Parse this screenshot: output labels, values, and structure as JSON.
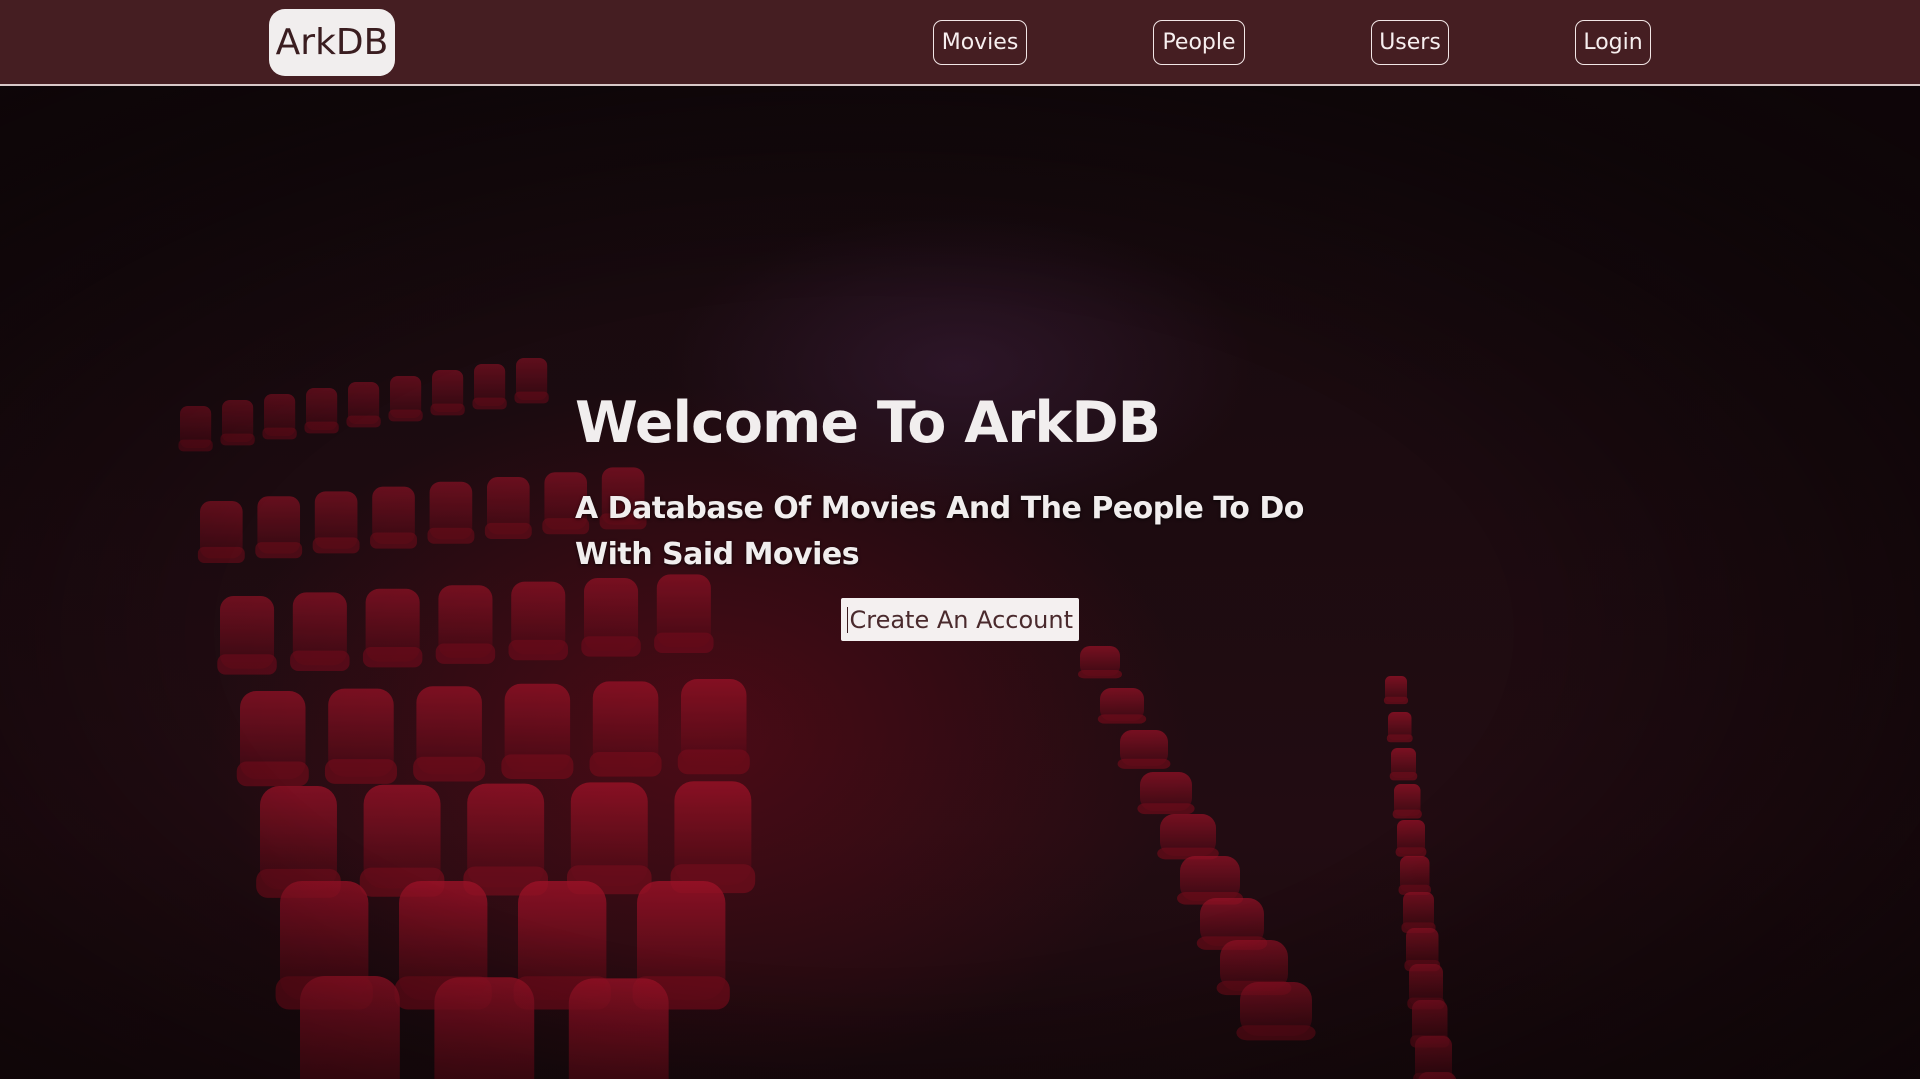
{
  "brand": {
    "label": "ArkDB"
  },
  "nav": {
    "items": [
      {
        "label": "Movies"
      },
      {
        "label": "People"
      },
      {
        "label": "Users"
      },
      {
        "label": "Login"
      }
    ]
  },
  "hero": {
    "title": "Welcome To ArkDB",
    "subtitle": "A Database Of Movies And The People To Do With Said Movies",
    "cta_label": "Create An Account",
    "background_image": "dark cinema auditorium with red seats"
  },
  "colors": {
    "navbar_bg": "#451e22",
    "brand_bg": "#f1eeee",
    "hero_text": "#f1eeee",
    "seat_red": "#a5122a"
  }
}
